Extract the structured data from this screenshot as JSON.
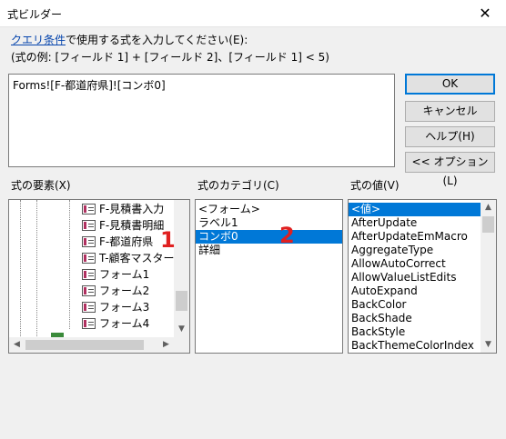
{
  "window": {
    "title": "式ビルダー",
    "close_glyph": "✕"
  },
  "description": {
    "link": "クエリ条件",
    "rest": "で使用する式を入力してください(E):",
    "example": "(式の例: [フィールド 1] + [フィールド 2]、[フィールド 1] < 5)"
  },
  "expression": {
    "value": "Forms![F-都道府県]![コンボ0]"
  },
  "buttons": {
    "ok": "OK",
    "cancel": "キャンセル",
    "help": "ヘルプ(H)",
    "options": "<< オプション(L)"
  },
  "elements": {
    "label": "式の要素(X)",
    "items": [
      "F-見積書入力",
      "F-見積書明細",
      "F-都道府県",
      "T-顧客マスター",
      "フォーム1",
      "フォーム2",
      "フォーム3",
      "フォーム4"
    ]
  },
  "categories": {
    "label": "式のカテゴリ(C)",
    "items": [
      "<フォーム>",
      "ラベル1",
      "コンボ0",
      "詳細"
    ],
    "selected": "コンボ0"
  },
  "values": {
    "label": "式の値(V)",
    "items": [
      "<値>",
      "AfterUpdate",
      "AfterUpdateEmMacro",
      "AggregateType",
      "AllowAutoCorrect",
      "AllowValueListEdits",
      "AutoExpand",
      "BackColor",
      "BackShade",
      "BackStyle",
      "BackThemeColorIndex"
    ],
    "selected": "<値>"
  },
  "annotations": {
    "mark1": "1",
    "mark2": "2"
  },
  "colors": {
    "selection": "#0078d7",
    "annotation": "#e02020",
    "link": "#0645ad"
  }
}
